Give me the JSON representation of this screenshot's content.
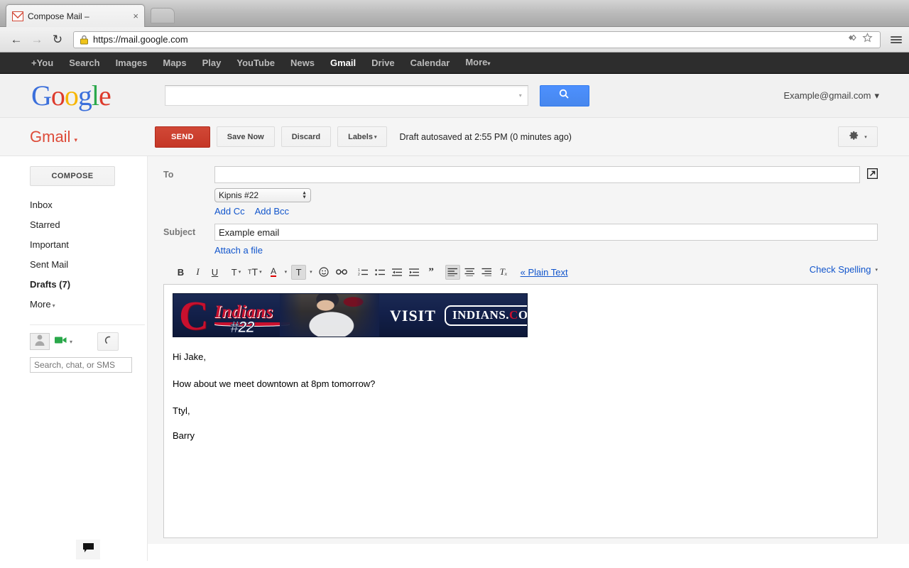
{
  "browser": {
    "tab": {
      "title": "Compose Mail –",
      "favicon": "gmail-envelope-icon",
      "close": "×"
    },
    "nav": {
      "back": "←",
      "forward": "→",
      "reload": "↻"
    },
    "address": {
      "url": "https://mail.google.com",
      "lock": "insecure-https-lock-icon"
    },
    "toolbar_icons": [
      "extension-icon",
      "bookmark-star-icon",
      "chrome-menu-icon"
    ]
  },
  "gbar": {
    "items": [
      {
        "label": "+You",
        "active": false
      },
      {
        "label": "Search",
        "active": false
      },
      {
        "label": "Images",
        "active": false
      },
      {
        "label": "Maps",
        "active": false
      },
      {
        "label": "Play",
        "active": false
      },
      {
        "label": "YouTube",
        "active": false
      },
      {
        "label": "News",
        "active": false
      },
      {
        "label": "Gmail",
        "active": true
      },
      {
        "label": "Drive",
        "active": false
      },
      {
        "label": "Calendar",
        "active": false
      },
      {
        "label": "More",
        "active": false
      }
    ],
    "more_caret": "▾"
  },
  "header": {
    "logo_letters": [
      "G",
      "o",
      "o",
      "g",
      "l",
      "e"
    ],
    "search": {
      "value": "",
      "placeholder": "",
      "caret": "▾"
    },
    "search_button_icon": "search-magnifier-icon",
    "account": {
      "email": "Example@gmail.com",
      "caret": "▾"
    }
  },
  "mail_toolbar": {
    "logo": "Gmail",
    "logo_caret": "▾",
    "send_label": "SEND",
    "save_label": "Save Now",
    "discard_label": "Discard",
    "labels_label": "Labels",
    "labels_caret": "▾",
    "autosave_status": "Draft autosaved at 2:55 PM (0 minutes ago)",
    "settings_icon": "gear-icon",
    "settings_caret": "▾"
  },
  "sidebar": {
    "compose_label": "COMPOSE",
    "items": [
      {
        "label": "Inbox",
        "bold": false
      },
      {
        "label": "Starred",
        "bold": false
      },
      {
        "label": "Important",
        "bold": false
      },
      {
        "label": "Sent Mail",
        "bold": false
      },
      {
        "label": "Drafts (7)",
        "bold": true
      }
    ],
    "more_label": "More",
    "more_caret": "▾",
    "chat": {
      "avatar_icon": "person-avatar-icon",
      "video_icon": "video-camera-icon",
      "video_caret": "▾",
      "call_icon": "phone-handset-icon",
      "search_value": "",
      "search_placeholder": "Search, chat, or SMS",
      "bubble_icon": "chat-bubble-icon"
    }
  },
  "compose": {
    "to_label": "To",
    "to_value": "",
    "popout_icon": "pop-out-window-icon",
    "recipient_select": {
      "value": "Kipnis #22",
      "options": [
        "Kipnis #22"
      ]
    },
    "add_cc": "Add Cc",
    "add_bcc": "Add Bcc",
    "subject_label": "Subject",
    "subject_value": "Example email",
    "attach_link": "Attach a file",
    "format_toolbar": {
      "bold": "B",
      "italic": "I",
      "underline": "U",
      "font": "T",
      "font_size": "₁T",
      "text_color": "A",
      "highlight": "T",
      "emoji": "☺",
      "link": "⚭",
      "numbered_list": "≡",
      "bulleted_list": "☰",
      "outdent": "⇤",
      "indent": "⇥",
      "quote": "”",
      "align_left": "≡",
      "align_center": "≡",
      "align_right": "≡",
      "remove_format": "Tₓ",
      "caret": "▾",
      "plain_text": "« Plain Text",
      "check_spelling": "Check Spelling",
      "check_spelling_caret": "▾"
    },
    "body": {
      "banner": {
        "team_initial": "C",
        "script": "Indians",
        "number": "#22",
        "visit": "VISIT",
        "site_pre": "INDIANS.",
        "site_c": "C",
        "site_post": "OM"
      },
      "lines": [
        "Hi Jake,",
        "How about we meet downtown at 8pm tomorrow?",
        "Ttyl,",
        "Barry"
      ]
    }
  },
  "colors": {
    "send_red": "#c53727",
    "gmail_red": "#dd4b39",
    "link_blue": "#1155cc",
    "search_blue": "#4d90fe",
    "indians_navy": "#13204a",
    "indians_red": "#c8102e"
  }
}
